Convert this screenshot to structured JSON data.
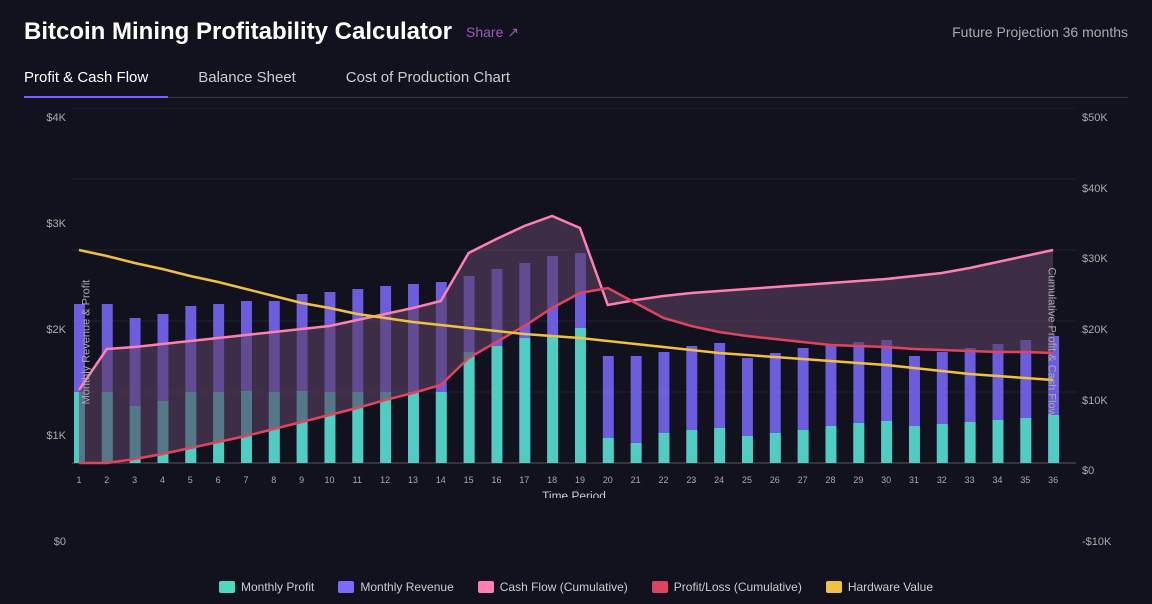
{
  "header": {
    "title": "Bitcoin Mining Profitability Calculator",
    "share_label": "Share ↗",
    "future_projection": "Future Projection 36 months"
  },
  "tabs": [
    {
      "label": "Profit & Cash Flow",
      "active": true
    },
    {
      "label": "Balance Sheet",
      "active": false
    },
    {
      "label": "Cost of Production Chart",
      "active": false
    }
  ],
  "chart": {
    "y_left_label": "Monthly Revenue & Profit",
    "y_right_label": "Cumulative Profit & Cash Flow",
    "x_label": "Time Period",
    "y_left_ticks": [
      "$4K",
      "$3K",
      "$2K",
      "$1K",
      "$0"
    ],
    "y_right_ticks": [
      "$50K",
      "$40K",
      "$30K",
      "$20K",
      "$10K",
      "$0",
      "-$10K"
    ],
    "x_ticks": [
      "1",
      "2",
      "3",
      "4",
      "5",
      "6",
      "7",
      "8",
      "9",
      "10",
      "11",
      "12",
      "13",
      "14",
      "15",
      "16",
      "17",
      "18",
      "19",
      "20",
      "21",
      "22",
      "23",
      "24",
      "25",
      "26",
      "27",
      "28",
      "29",
      "30",
      "31",
      "32",
      "33",
      "34",
      "35",
      "36"
    ]
  },
  "legend": [
    {
      "label": "Monthly Profit",
      "color": "#4dd9c0"
    },
    {
      "label": "Monthly Revenue",
      "color": "#7b6bff"
    },
    {
      "label": "Cash Flow (Cumulative)",
      "color": "#ff80b0"
    },
    {
      "label": "Profit/Loss (Cumulative)",
      "color": "#e0445c"
    },
    {
      "label": "Hardware Value",
      "color": "#f0c040"
    }
  ],
  "colors": {
    "background": "#12121f",
    "tab_active_underline": "#7b61ff",
    "share": "#9b59b6"
  }
}
